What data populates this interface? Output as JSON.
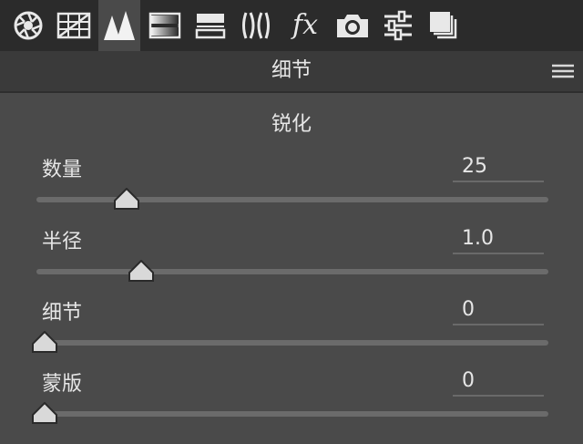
{
  "toolbar": {
    "tabs": [
      {
        "name": "aperture-icon",
        "active": false
      },
      {
        "name": "grid-icon",
        "active": false
      },
      {
        "name": "detail-triangles-icon",
        "active": true
      },
      {
        "name": "gradient-bars-icon",
        "active": false
      },
      {
        "name": "split-bars-icon",
        "active": false
      },
      {
        "name": "lens-icon",
        "active": false
      },
      {
        "name": "fx-icon",
        "active": false,
        "glyph": "fx"
      },
      {
        "name": "camera-icon",
        "active": false
      },
      {
        "name": "sliders-icon",
        "active": false
      },
      {
        "name": "stack-icon",
        "active": false
      }
    ]
  },
  "panel": {
    "title": "细节",
    "section_title": "锐化"
  },
  "sliders": [
    {
      "label": "数量",
      "value": "25",
      "level": 0.17
    },
    {
      "label": "半径",
      "value": "1.0",
      "level": 0.2
    },
    {
      "label": "细节",
      "value": "0",
      "level": 0.0
    },
    {
      "label": "蒙版",
      "value": "0",
      "level": 0.0
    }
  ],
  "colors": {
    "toolbar_bg": "#2b2b2b",
    "panel_bg": "#4a4a4a",
    "header_bg": "#3a3a3a",
    "track": "#6b6b6b",
    "thumb": "#d9d9d9"
  }
}
